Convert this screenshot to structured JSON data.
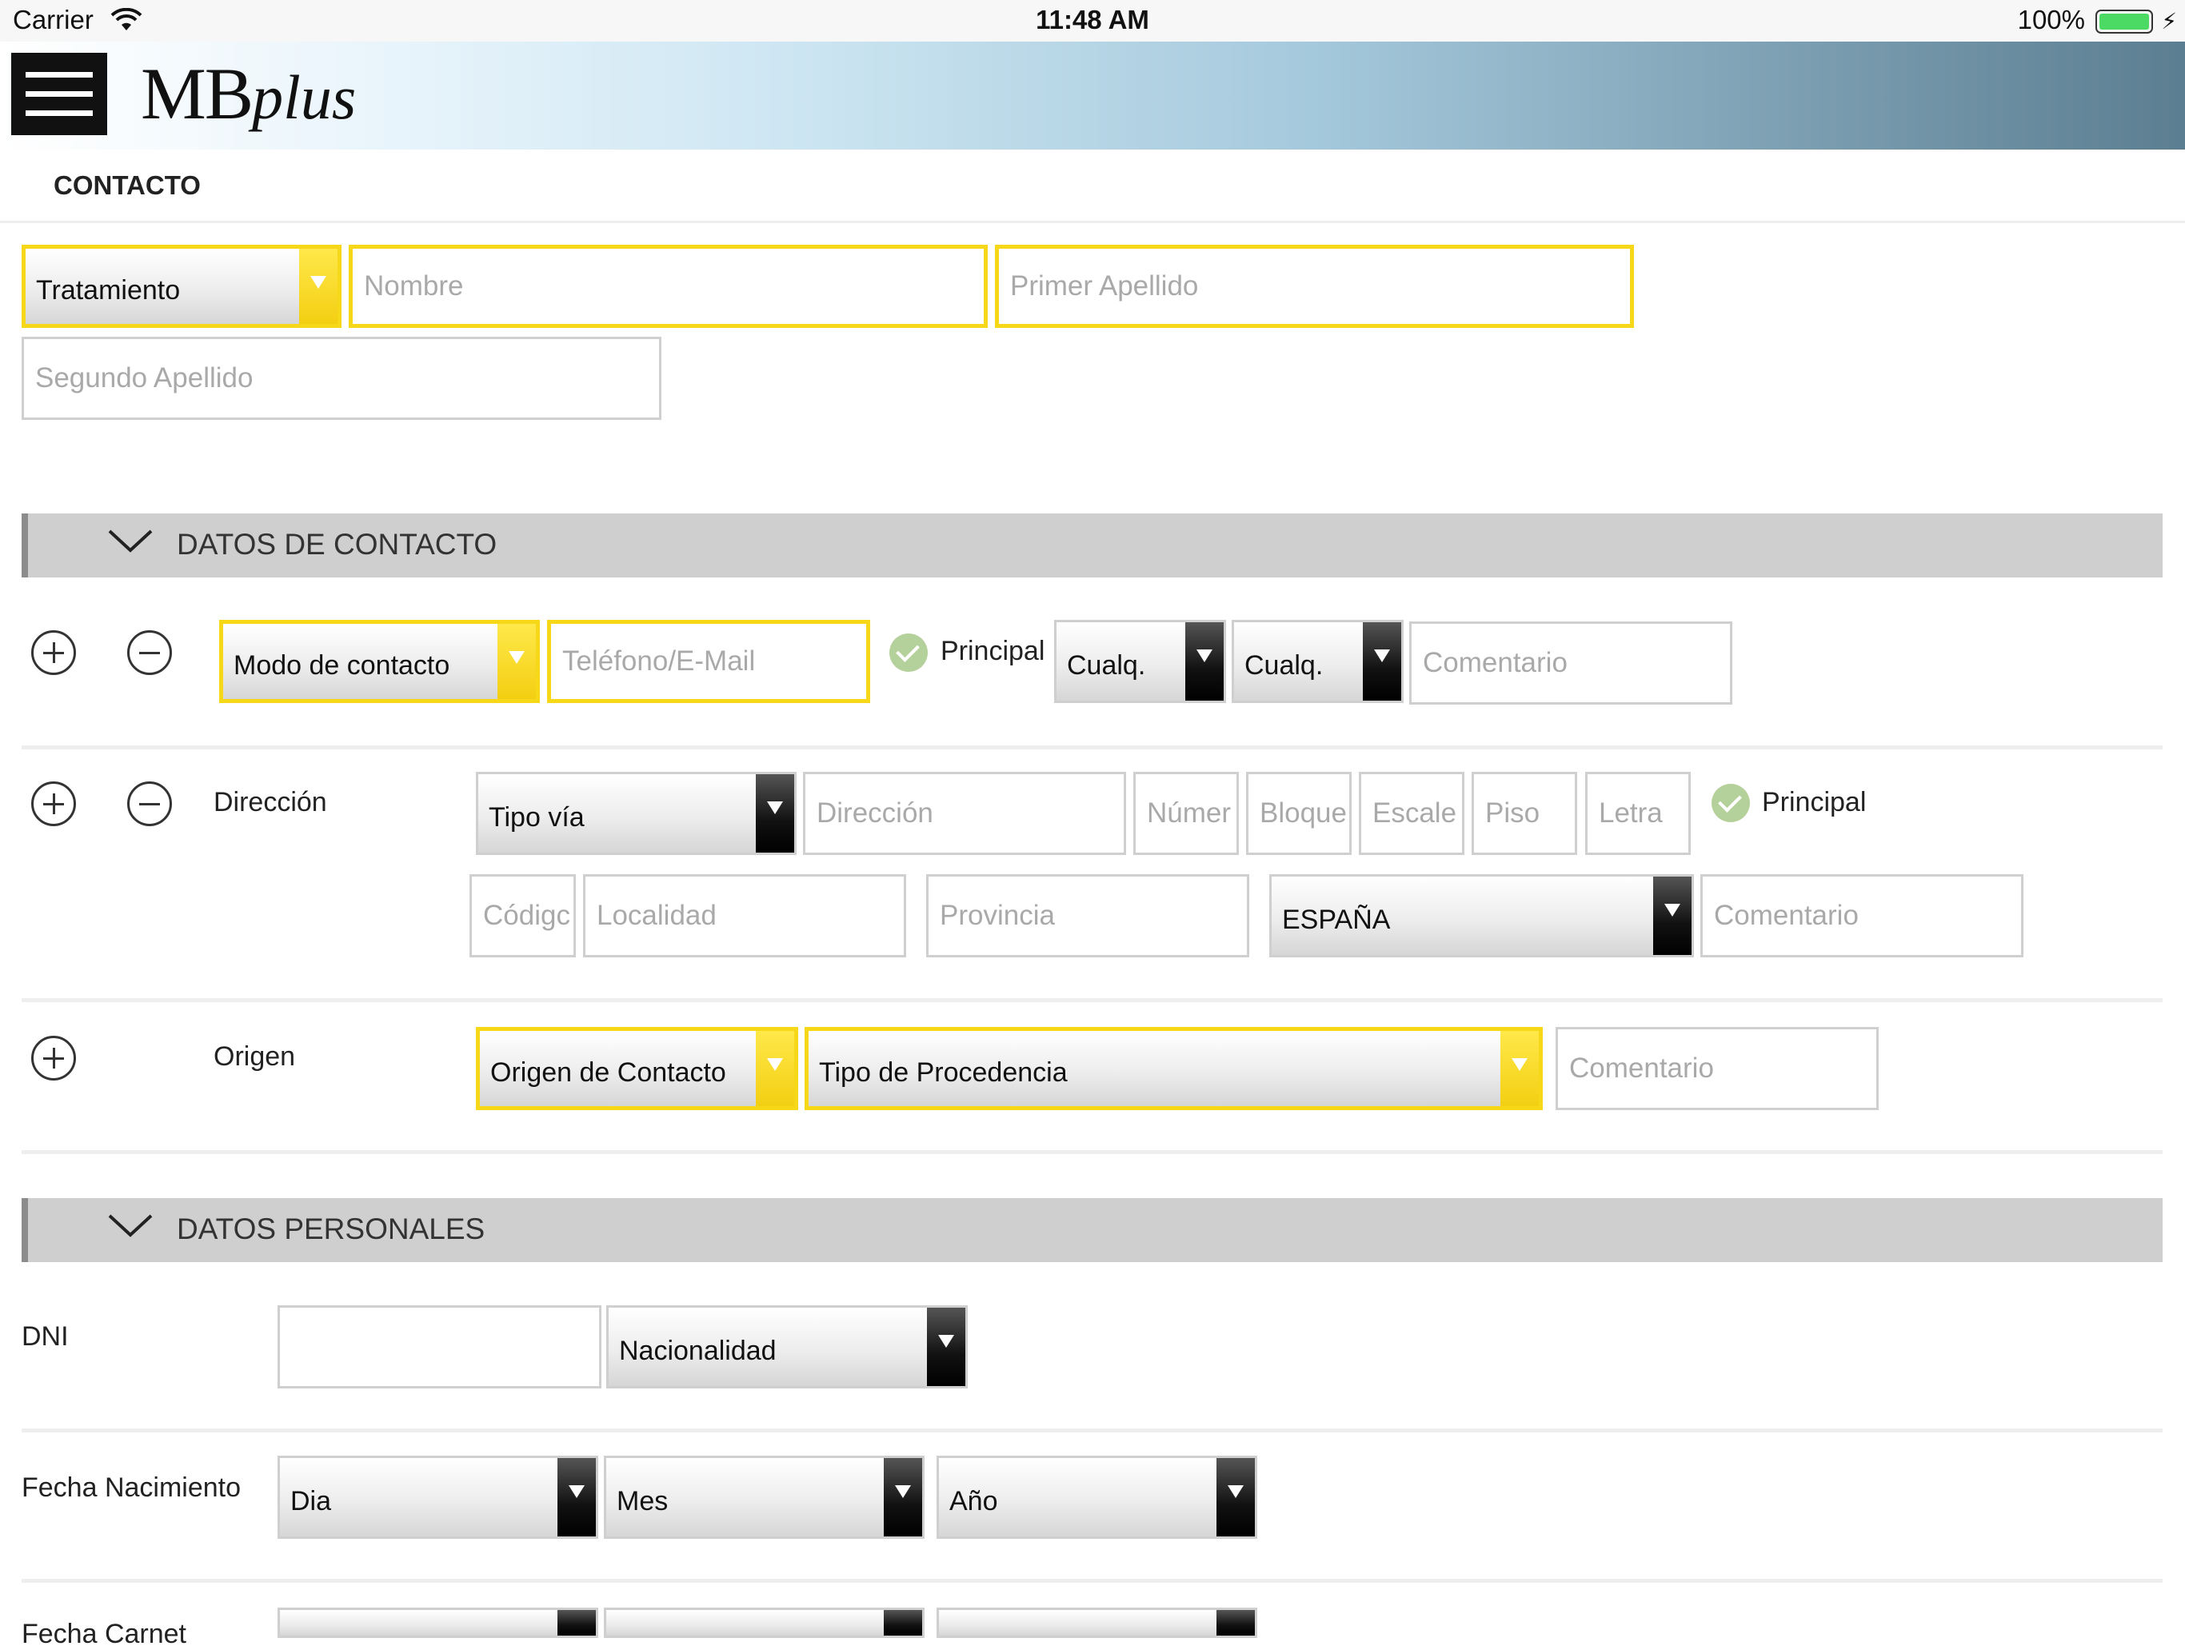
{
  "status_bar": {
    "carrier": "Carrier",
    "time": "11:48 AM",
    "battery": "100%"
  },
  "header": {
    "logo_main": "MB",
    "logo_italic": "plus"
  },
  "page": {
    "title": "CONTACTO"
  },
  "name_fields": {
    "tratamiento": "Tratamiento",
    "nombre_placeholder": "Nombre",
    "primer_apellido_placeholder": "Primer Apellido",
    "segundo_apellido_placeholder": "Segundo Apellido"
  },
  "datos_contacto": {
    "title": "DATOS DE CONTACTO",
    "modo_contacto": "Modo de contacto",
    "telefono_placeholder": "Teléfono/E-Mail",
    "principal": "Principal",
    "cualq_1": "Cualq.",
    "cualq_2": "Cualq.",
    "comentario_placeholder": "Comentario",
    "direccion": {
      "label": "Dirección",
      "tipo_via": "Tipo vía",
      "direccion_placeholder": "Dirección",
      "numero_placeholder": "Númer",
      "bloque_placeholder": "Bloque",
      "escalera_placeholder": "Escale",
      "piso_placeholder": "Piso",
      "letra_placeholder": "Letra",
      "principal": "Principal",
      "codigo_placeholder": "Códigc",
      "localidad_placeholder": "Localidad",
      "provincia_placeholder": "Provincia",
      "pais": "ESPAÑA",
      "comentario_placeholder": "Comentario"
    },
    "origen": {
      "label": "Origen",
      "origen_contacto": "Origen de Contacto",
      "tipo_procedencia": "Tipo de Procedencia",
      "comentario_placeholder": "Comentario"
    }
  },
  "datos_personales": {
    "title": "DATOS PERSONALES",
    "dni_label": "DNI",
    "dni_value": "",
    "nacionalidad": "Nacionalidad",
    "fecha_nacimiento_label": "Fecha Nacimiento",
    "dia": "Dia",
    "mes": "Mes",
    "anio": "Año",
    "fecha_carnet_label": "Fecha Carnet"
  },
  "colors": {
    "accent_yellow": "#f7d819",
    "principal_check": "#b5d19b",
    "section_bar": "#cfcfcf"
  },
  "icons": [
    "menu-icon",
    "wifi-icon",
    "battery-icon",
    "chevron-down-icon",
    "plus-circle-icon",
    "minus-circle-icon",
    "check-circle-icon",
    "dropdown-arrow-icon"
  ]
}
